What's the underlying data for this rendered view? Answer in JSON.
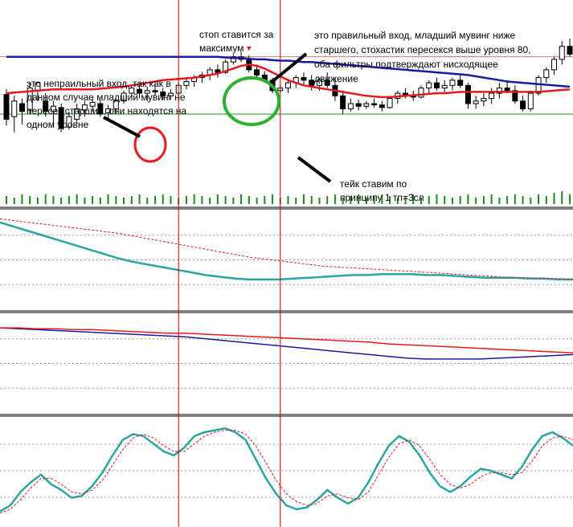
{
  "colors": {
    "background": "#ffffff",
    "candle_up": "#000000",
    "candle_down": "#000000",
    "fast_ma": "#e41a1c",
    "slow_ma": "#1a1aa6",
    "stoch_main": "#2aa5a0",
    "stoch_signal": "#e41a1c",
    "volume": "#1f8a1f",
    "marker_line": "#c00000",
    "level_red": "#e07070",
    "level_green": "#2e8b2e",
    "annotation_arrow": "#000000",
    "circle_red": "#e41a1c",
    "circle_green": "#2db02d",
    "signal_arrow": "#e41a1c"
  },
  "annotations": {
    "wrong_entry": [
      "это непраильный вход, так как в",
      "данном случае младший мувинг не",
      "пересек старший, они находятся на",
      "одном уровне"
    ],
    "stop": [
      "стоп ставится за",
      "максимум"
    ],
    "right_entry": [
      "это правильный вход, младший мувинг ниже",
      "старшего, стохастик пересекся выше уровня 80,",
      "оба фильтры подтверждают нисходящее",
      "движение"
    ],
    "take": [
      "тейк ставим по",
      "принципу 1 тп=3сл"
    ]
  },
  "chart_data": [
    {
      "type": "candlestick",
      "panel": "price",
      "title": "",
      "xlabel": "",
      "ylabel": "",
      "grid": false,
      "ylim": [
        0,
        100
      ],
      "candles": [
        {
          "x": 0,
          "o": 57,
          "h": 61,
          "l": 33,
          "c": 38
        },
        {
          "x": 1,
          "o": 40,
          "h": 56,
          "l": 28,
          "c": 52
        },
        {
          "x": 2,
          "o": 50,
          "h": 54,
          "l": 34,
          "c": 44
        },
        {
          "x": 3,
          "o": 45,
          "h": 66,
          "l": 42,
          "c": 62
        },
        {
          "x": 4,
          "o": 60,
          "h": 67,
          "l": 52,
          "c": 66
        },
        {
          "x": 5,
          "o": 52,
          "h": 58,
          "l": 40,
          "c": 44
        },
        {
          "x": 6,
          "o": 44,
          "h": 52,
          "l": 32,
          "c": 48
        },
        {
          "x": 7,
          "o": 47,
          "h": 50,
          "l": 28,
          "c": 31
        },
        {
          "x": 8,
          "o": 32,
          "h": 44,
          "l": 30,
          "c": 40
        },
        {
          "x": 9,
          "o": 38,
          "h": 50,
          "l": 34,
          "c": 46
        },
        {
          "x": 10,
          "o": 45,
          "h": 52,
          "l": 40,
          "c": 49
        },
        {
          "x": 11,
          "o": 48,
          "h": 54,
          "l": 44,
          "c": 51
        },
        {
          "x": 12,
          "o": 50,
          "h": 53,
          "l": 40,
          "c": 42
        },
        {
          "x": 13,
          "o": 43,
          "h": 49,
          "l": 38,
          "c": 46
        },
        {
          "x": 14,
          "o": 46,
          "h": 54,
          "l": 42,
          "c": 52
        },
        {
          "x": 15,
          "o": 52,
          "h": 60,
          "l": 50,
          "c": 58
        },
        {
          "x": 16,
          "o": 58,
          "h": 64,
          "l": 55,
          "c": 62
        },
        {
          "x": 17,
          "o": 61,
          "h": 66,
          "l": 54,
          "c": 58
        },
        {
          "x": 18,
          "o": 58,
          "h": 63,
          "l": 52,
          "c": 60
        },
        {
          "x": 19,
          "o": 60,
          "h": 65,
          "l": 56,
          "c": 59
        },
        {
          "x": 20,
          "o": 59,
          "h": 62,
          "l": 53,
          "c": 56
        },
        {
          "x": 21,
          "o": 56,
          "h": 61,
          "l": 53,
          "c": 58
        },
        {
          "x": 22,
          "o": 58,
          "h": 66,
          "l": 56,
          "c": 64
        },
        {
          "x": 23,
          "o": 64,
          "h": 70,
          "l": 61,
          "c": 67
        },
        {
          "x": 24,
          "o": 67,
          "h": 72,
          "l": 63,
          "c": 70
        },
        {
          "x": 25,
          "o": 70,
          "h": 74,
          "l": 66,
          "c": 72
        },
        {
          "x": 26,
          "o": 72,
          "h": 78,
          "l": 68,
          "c": 76
        },
        {
          "x": 27,
          "o": 76,
          "h": 80,
          "l": 70,
          "c": 74
        },
        {
          "x": 28,
          "o": 74,
          "h": 84,
          "l": 73,
          "c": 82
        },
        {
          "x": 29,
          "o": 82,
          "h": 88,
          "l": 80,
          "c": 86
        },
        {
          "x": 30,
          "o": 86,
          "h": 90,
          "l": 82,
          "c": 84
        },
        {
          "x": 31,
          "o": 84,
          "h": 87,
          "l": 74,
          "c": 76
        },
        {
          "x": 32,
          "o": 76,
          "h": 80,
          "l": 70,
          "c": 72
        },
        {
          "x": 33,
          "o": 72,
          "h": 75,
          "l": 66,
          "c": 68
        },
        {
          "x": 34,
          "o": 68,
          "h": 70,
          "l": 58,
          "c": 60
        },
        {
          "x": 35,
          "o": 60,
          "h": 64,
          "l": 58,
          "c": 62
        },
        {
          "x": 36,
          "o": 62,
          "h": 68,
          "l": 58,
          "c": 66
        },
        {
          "x": 37,
          "o": 66,
          "h": 72,
          "l": 62,
          "c": 70
        },
        {
          "x": 38,
          "o": 70,
          "h": 74,
          "l": 64,
          "c": 68
        },
        {
          "x": 39,
          "o": 68,
          "h": 72,
          "l": 60,
          "c": 64
        },
        {
          "x": 40,
          "o": 64,
          "h": 70,
          "l": 60,
          "c": 68
        },
        {
          "x": 41,
          "o": 68,
          "h": 74,
          "l": 62,
          "c": 64
        },
        {
          "x": 42,
          "o": 64,
          "h": 70,
          "l": 52,
          "c": 56
        },
        {
          "x": 43,
          "o": 56,
          "h": 60,
          "l": 42,
          "c": 46
        },
        {
          "x": 44,
          "o": 46,
          "h": 54,
          "l": 44,
          "c": 50
        },
        {
          "x": 45,
          "o": 50,
          "h": 53,
          "l": 45,
          "c": 48
        },
        {
          "x": 46,
          "o": 48,
          "h": 52,
          "l": 46,
          "c": 50
        },
        {
          "x": 47,
          "o": 50,
          "h": 54,
          "l": 47,
          "c": 49
        },
        {
          "x": 48,
          "o": 49,
          "h": 52,
          "l": 44,
          "c": 47
        },
        {
          "x": 49,
          "o": 47,
          "h": 56,
          "l": 46,
          "c": 54
        },
        {
          "x": 50,
          "o": 54,
          "h": 60,
          "l": 50,
          "c": 58
        },
        {
          "x": 51,
          "o": 58,
          "h": 62,
          "l": 54,
          "c": 56
        },
        {
          "x": 52,
          "o": 56,
          "h": 60,
          "l": 52,
          "c": 55
        },
        {
          "x": 53,
          "o": 55,
          "h": 64,
          "l": 54,
          "c": 62
        },
        {
          "x": 54,
          "o": 62,
          "h": 68,
          "l": 58,
          "c": 66
        },
        {
          "x": 55,
          "o": 66,
          "h": 70,
          "l": 60,
          "c": 62
        },
        {
          "x": 56,
          "o": 62,
          "h": 68,
          "l": 58,
          "c": 64
        },
        {
          "x": 57,
          "o": 64,
          "h": 70,
          "l": 60,
          "c": 68
        },
        {
          "x": 58,
          "o": 68,
          "h": 72,
          "l": 62,
          "c": 64
        },
        {
          "x": 59,
          "o": 64,
          "h": 66,
          "l": 46,
          "c": 50
        },
        {
          "x": 60,
          "o": 50,
          "h": 56,
          "l": 46,
          "c": 52
        },
        {
          "x": 61,
          "o": 52,
          "h": 58,
          "l": 48,
          "c": 54
        },
        {
          "x": 62,
          "o": 54,
          "h": 62,
          "l": 50,
          "c": 58
        },
        {
          "x": 63,
          "o": 58,
          "h": 66,
          "l": 54,
          "c": 62
        },
        {
          "x": 64,
          "o": 62,
          "h": 68,
          "l": 58,
          "c": 60
        },
        {
          "x": 65,
          "o": 60,
          "h": 64,
          "l": 50,
          "c": 52
        },
        {
          "x": 66,
          "o": 52,
          "h": 56,
          "l": 44,
          "c": 46
        },
        {
          "x": 67,
          "o": 46,
          "h": 60,
          "l": 44,
          "c": 58
        },
        {
          "x": 68,
          "o": 58,
          "h": 72,
          "l": 56,
          "c": 70
        },
        {
          "x": 69,
          "o": 70,
          "h": 78,
          "l": 66,
          "c": 76
        },
        {
          "x": 70,
          "o": 76,
          "h": 86,
          "l": 72,
          "c": 84
        },
        {
          "x": 71,
          "o": 84,
          "h": 98,
          "l": 80,
          "c": 94
        },
        {
          "x": 72,
          "o": 94,
          "h": 100,
          "l": 86,
          "c": 88
        }
      ],
      "fast_ma": [
        58,
        58.5,
        59,
        59.5,
        60,
        60.5,
        61,
        61,
        61,
        61,
        61,
        61,
        61.5,
        62,
        62.5,
        63,
        64,
        65,
        66,
        67,
        68,
        68.5,
        69,
        69.5,
        70,
        71,
        72,
        73,
        75,
        77,
        79,
        80,
        79,
        77,
        74,
        71,
        68,
        66,
        64,
        63,
        62,
        61,
        60,
        59,
        58,
        57,
        56,
        55.5,
        55,
        55,
        55.5,
        56,
        56.5,
        57,
        57.5,
        58,
        58,
        58.5,
        59,
        59,
        59,
        59,
        59,
        59,
        59,
        59,
        59,
        59,
        59,
        59.5,
        60,
        60.5,
        61
      ],
      "slow_ma": [
        86,
        86,
        86,
        86,
        86,
        86,
        86,
        86,
        86,
        86,
        86,
        86,
        86,
        86,
        86,
        86,
        86,
        86,
        86,
        86,
        86,
        86,
        86,
        86,
        86,
        86,
        86,
        86,
        85.5,
        85,
        85,
        84.5,
        84,
        84,
        83.5,
        83,
        83,
        82.5,
        82,
        82,
        81.5,
        81,
        80.5,
        80,
        79.5,
        79,
        78.5,
        78,
        77.5,
        77,
        76.5,
        76,
        75.5,
        75,
        74.5,
        74,
        73.5,
        73,
        72.5,
        72,
        71,
        70,
        69,
        68,
        67,
        66.5,
        66,
        65.5,
        65,
        64.5,
        64,
        63.5,
        63
      ],
      "volume": [
        5,
        4,
        6,
        5,
        4,
        6,
        5,
        4,
        5,
        6,
        4,
        5,
        4,
        6,
        5,
        4,
        5,
        6,
        4,
        5,
        6,
        5,
        4,
        5,
        6,
        5,
        4,
        6,
        5,
        4,
        6,
        5,
        4,
        5,
        6,
        4,
        5,
        4,
        6,
        5,
        4,
        5,
        6,
        4,
        5,
        6,
        4,
        5,
        6,
        5,
        4,
        5,
        6,
        4,
        5,
        6,
        5,
        4,
        5,
        6,
        4,
        5,
        6,
        4,
        5,
        6,
        5,
        4,
        6,
        5,
        7,
        8,
        6
      ],
      "levels": {
        "upper": 86,
        "lower": 42
      },
      "signal_arrow_index": 31,
      "vlines_index": [
        22,
        35
      ]
    },
    {
      "type": "line",
      "panel": "indicator_1",
      "title": "",
      "xlabel": "",
      "ylabel": "",
      "grid": true,
      "ylim": [
        0,
        100
      ],
      "series": [
        {
          "values": [
            92,
            87,
            82,
            77,
            72,
            67,
            62,
            57,
            52,
            48,
            45,
            42,
            39,
            36,
            33,
            31,
            29,
            28,
            28,
            28,
            29,
            30,
            31,
            32,
            33,
            33,
            34,
            34,
            34,
            33,
            33,
            32,
            31,
            30,
            30,
            30,
            29,
            29,
            28,
            28
          ]
        },
        {
          "values": [
            96,
            94,
            92,
            90,
            88,
            86,
            84,
            82,
            80,
            77,
            74,
            71,
            68,
            65,
            62,
            59,
            56,
            53,
            51,
            49,
            47,
            45,
            43,
            42,
            41,
            40,
            39,
            38,
            37,
            36,
            35,
            34,
            33,
            32,
            31,
            30,
            30,
            29,
            29,
            28
          ]
        }
      ]
    },
    {
      "type": "line",
      "panel": "indicator_2",
      "title": "",
      "xlabel": "",
      "ylabel": "",
      "grid": true,
      "ylim": [
        0,
        100
      ],
      "series": [
        {
          "values": [
            90,
            89,
            88,
            87,
            86,
            85,
            84,
            83,
            82,
            81,
            80,
            78,
            76,
            74,
            72,
            70,
            68,
            66,
            64,
            62,
            60,
            58,
            56,
            55,
            55,
            55,
            55,
            56,
            57,
            58,
            59,
            60
          ]
        },
        {
          "values": [
            90,
            90,
            89,
            89,
            88,
            88,
            87,
            86,
            85,
            84,
            84,
            83,
            82,
            81,
            80,
            79,
            78,
            77,
            76,
            75,
            74,
            72,
            71,
            70,
            69,
            68,
            67,
            66,
            65,
            64,
            63,
            62
          ]
        }
      ]
    },
    {
      "type": "line",
      "panel": "stochastic",
      "title": "",
      "xlabel": "",
      "ylabel": "",
      "grid": true,
      "ylim": [
        0,
        100
      ],
      "levels": [
        80,
        20
      ],
      "series": [
        {
          "values": [
            8,
            14,
            28,
            38,
            46,
            36,
            30,
            22,
            24,
            34,
            48,
            66,
            82,
            88,
            86,
            78,
            70,
            66,
            74,
            86,
            90,
            92,
            94,
            90,
            82,
            62,
            42,
            26,
            14,
            10,
            12,
            20,
            30,
            22,
            16,
            22,
            38,
            58,
            76,
            86,
            80,
            66,
            48,
            34,
            28,
            34,
            44,
            52,
            50,
            46,
            42,
            54,
            72,
            86,
            90,
            84,
            76
          ]
        },
        {
          "values": [
            6,
            10,
            20,
            32,
            42,
            42,
            36,
            28,
            26,
            30,
            40,
            56,
            72,
            84,
            88,
            84,
            76,
            70,
            70,
            78,
            86,
            90,
            92,
            92,
            88,
            76,
            58,
            40,
            26,
            18,
            14,
            16,
            24,
            26,
            22,
            20,
            28,
            46,
            64,
            78,
            82,
            76,
            62,
            46,
            36,
            32,
            36,
            44,
            48,
            48,
            46,
            48,
            60,
            76,
            84,
            86,
            82
          ]
        }
      ]
    }
  ]
}
